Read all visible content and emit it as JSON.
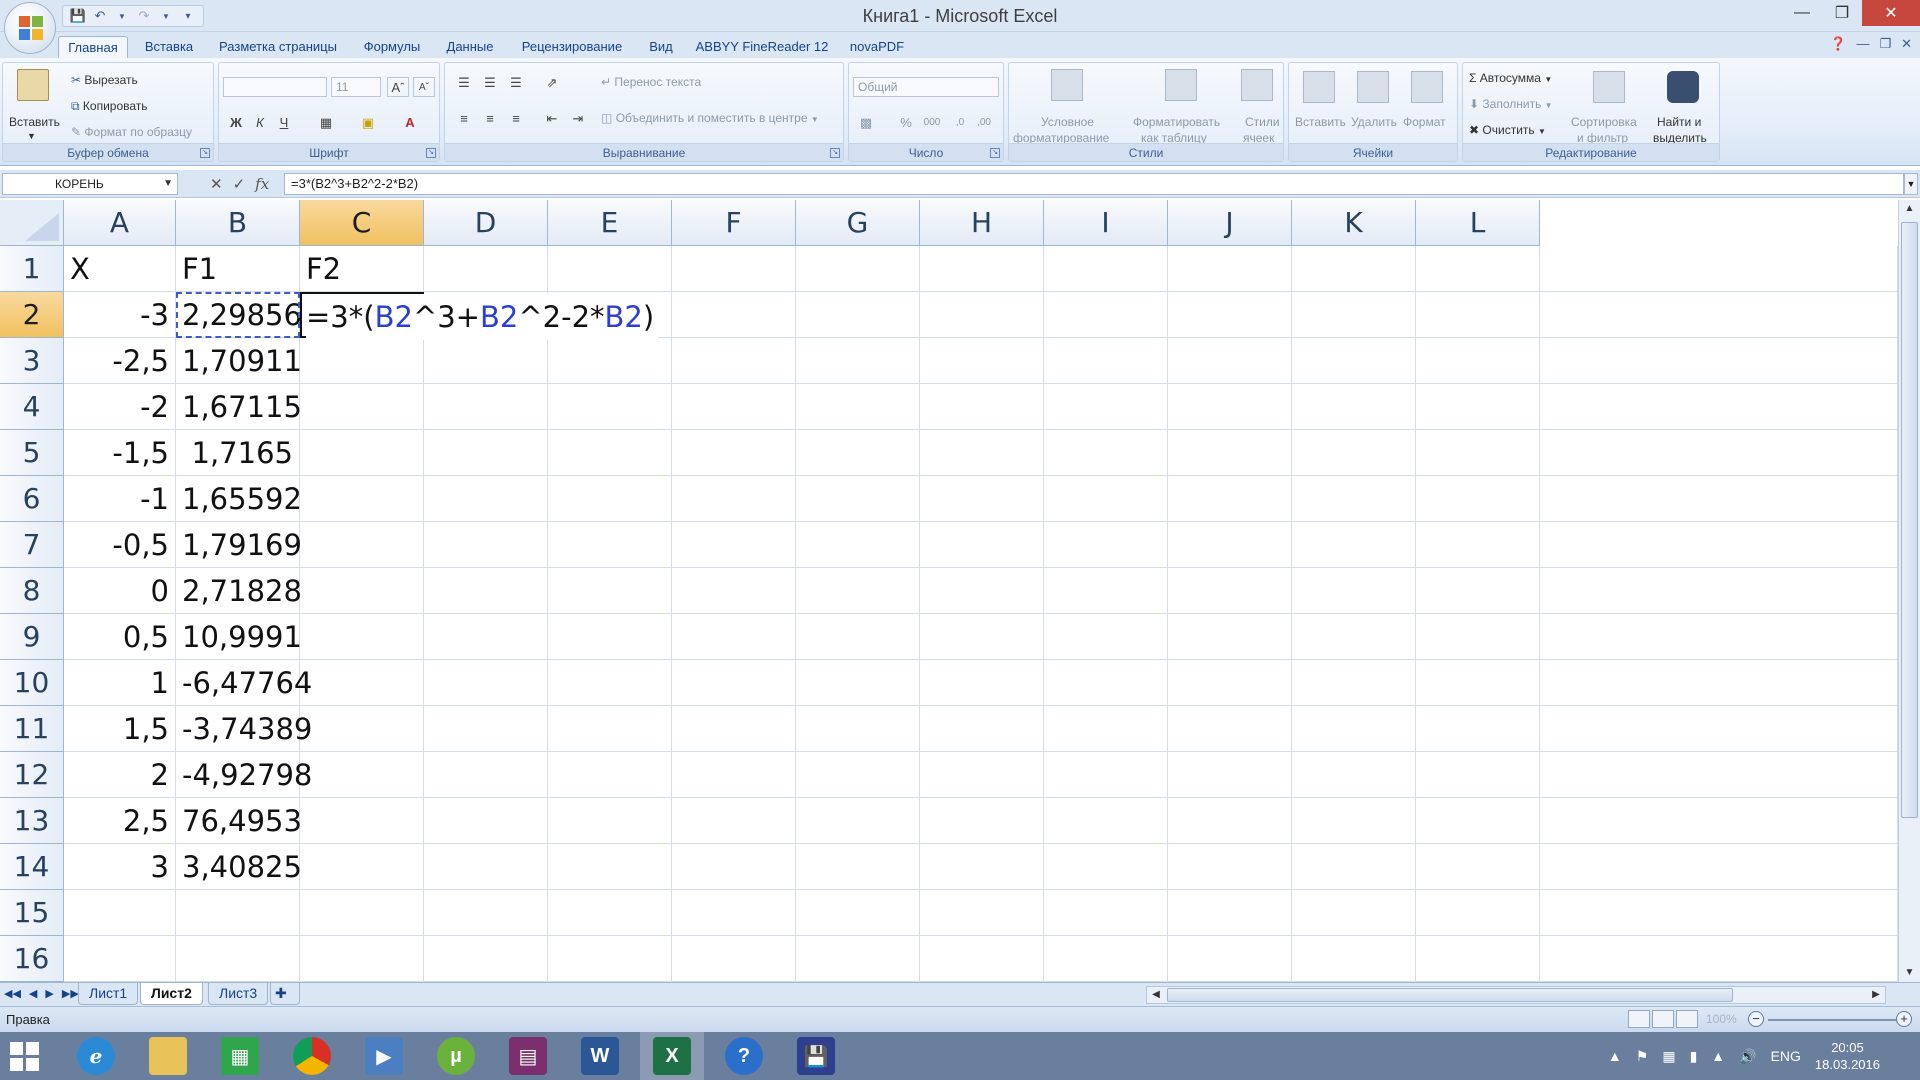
{
  "window": {
    "title": "Книга1 - Microsoft Excel",
    "min": "—",
    "max": "❐",
    "close": "✕"
  },
  "qat": {
    "save_icon": "save-icon",
    "undo_icon": "undo-icon",
    "redo_icon": "redo-icon"
  },
  "tabs": [
    "Главная",
    "Вставка",
    "Разметка страницы",
    "Формулы",
    "Данные",
    "Рецензирование",
    "Вид",
    "ABBYY FineReader 12",
    "novaPDF"
  ],
  "ribbon": {
    "clipboard": {
      "label": "Буфер обмена",
      "paste": "Вставить",
      "cut": "Вырезать",
      "copy": "Копировать",
      "format_painter": "Формат по образцу"
    },
    "font": {
      "label": "Шрифт",
      "size": "11",
      "bold": "Ж",
      "italic": "К",
      "underline": "Ч"
    },
    "alignment": {
      "label": "Выравнивание",
      "wrap": "Перенос текста",
      "merge": "Объединить и поместить в центре"
    },
    "number": {
      "label": "Число",
      "format": "Общий",
      "percent": "%",
      "thousands": "000"
    },
    "styles": {
      "label": "Стили",
      "conditional_1": "Условное",
      "conditional_2": "форматирование",
      "as_table_1": "Форматировать",
      "as_table_2": "как таблицу",
      "cell_styles_1": "Стили",
      "cell_styles_2": "ячеек"
    },
    "cells": {
      "label": "Ячейки",
      "insert": "Вставить",
      "delete": "Удалить",
      "format": "Формат"
    },
    "editing": {
      "label": "Редактирование",
      "autosum": "Автосумма",
      "fill": "Заполнить",
      "clear": "Очистить",
      "sort_1": "Сортировка",
      "sort_2": "и фильтр",
      "find_1": "Найти и",
      "find_2": "выделить"
    }
  },
  "formula_bar": {
    "name_box": "КОРЕНЬ",
    "formula": "=3*(B2^3+B2^2-2*B2)",
    "fx": "fx"
  },
  "columns": [
    "A",
    "B",
    "C",
    "D",
    "E",
    "F",
    "G",
    "H",
    "I",
    "J",
    "K",
    "L"
  ],
  "rows": [
    "1",
    "2",
    "3",
    "4",
    "5",
    "6",
    "7",
    "8",
    "9",
    "10",
    "11",
    "12",
    "13",
    "14",
    "15",
    "16"
  ],
  "cells": {
    "A1": "X",
    "B1": "F1",
    "C1": "F2",
    "A": [
      "-3",
      "-2,5",
      "-2",
      "-1,5",
      "-1",
      "-0,5",
      "0",
      "0,5",
      "1",
      "1,5",
      "2",
      "2,5",
      "3"
    ],
    "B": [
      "2,29856",
      "1,70911",
      "1,67115",
      "1,7165",
      "1,65592",
      "1,79169",
      "2,71828",
      "10,9991",
      "-6,47764",
      "-3,74389",
      "-4,92798",
      "76,4953",
      "3,40825"
    ]
  },
  "editor": {
    "p1": "=3*(",
    "r1": "B2",
    "p2": "^3+",
    "r2": "B2",
    "p3": "^2-2*",
    "r3": "B2",
    "p4": ")"
  },
  "sheets": [
    "Лист1",
    "Лист2",
    "Лист3"
  ],
  "active_sheet": "Лист2",
  "status": {
    "mode": "Правка",
    "zoom": "100%"
  },
  "taskbar": {
    "apps": [
      "internet-explorer",
      "file-explorer",
      "store",
      "chrome",
      "media-player",
      "utorrent",
      "winrar",
      "word",
      "excel",
      "help",
      "save-app"
    ],
    "lang": "ENG",
    "time": "20:05",
    "date": "18.03.2016"
  },
  "colors": {
    "accent": "#15428b",
    "selected_header": "#f1c15f",
    "reference": "#2a3fd0",
    "taskbar": "#6a7f9e"
  }
}
